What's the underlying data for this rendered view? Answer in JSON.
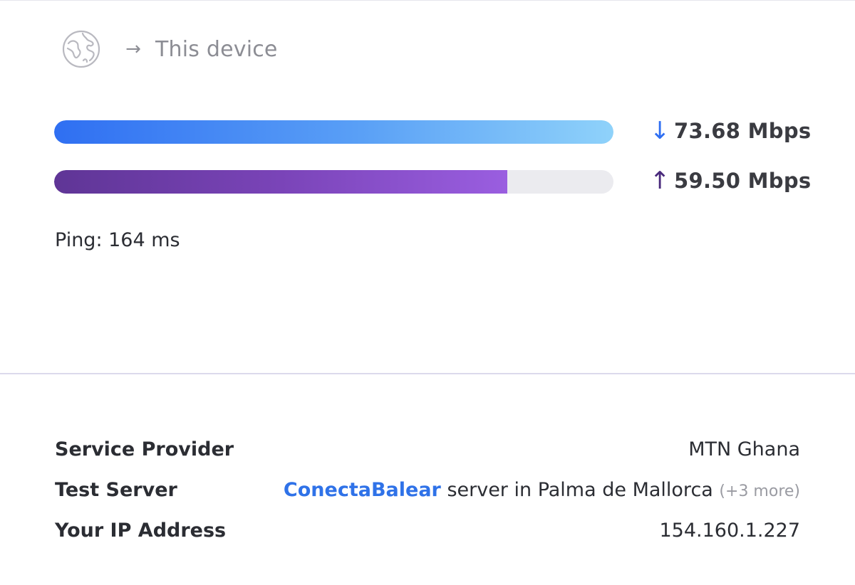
{
  "header": {
    "globe_icon": "globe-icon",
    "arrow": "→",
    "destination": "This device"
  },
  "download": {
    "direction_icon": "↓",
    "speed": "73.68 Mbps",
    "fill_fraction": 1.0
  },
  "upload": {
    "direction_icon": "↑",
    "speed": "59.50 Mbps",
    "fill_fraction": 0.81
  },
  "ping": "Ping: 164 ms",
  "details": {
    "provider_label": "Service Provider",
    "provider_value": "MTN Ghana",
    "server_label": "Test Server",
    "server_name": "ConectaBalear",
    "server_location": " server in Palma de Mallorca ",
    "server_more": "(+3 more)",
    "ip_label": "Your IP Address",
    "ip_value": "154.160.1.227"
  },
  "colors": {
    "download_start": "#2f6ff2",
    "download_end": "#8fd2fa",
    "upload_start": "#5f3596",
    "upload_end": "#9a5ee0",
    "link": "#2f72e8",
    "muted": "#8c8d94"
  }
}
